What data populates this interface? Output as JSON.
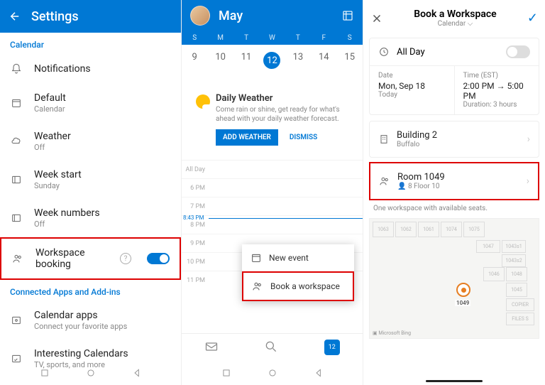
{
  "settings": {
    "title": "Settings",
    "section1": "Calendar",
    "items": [
      {
        "title": "Notifications",
        "sub": ""
      },
      {
        "title": "Default",
        "sub": "Calendar"
      },
      {
        "title": "Weather",
        "sub": "Off"
      },
      {
        "title": "Week start",
        "sub": "Sunday"
      },
      {
        "title": "Week numbers",
        "sub": "Off"
      },
      {
        "title": "Workspace booking",
        "sub": ""
      }
    ],
    "section2": "Connected Apps and Add-ins",
    "items2": [
      {
        "title": "Calendar apps",
        "sub": "Connect your favorite apps"
      },
      {
        "title": "Interesting Calendars",
        "sub": "TV, sports, and more"
      }
    ]
  },
  "calendar": {
    "month": "May",
    "dow": [
      "S",
      "M",
      "T",
      "W",
      "T",
      "F",
      "S"
    ],
    "dates": [
      "9",
      "10",
      "11",
      "12",
      "13",
      "14",
      "15"
    ],
    "selected": "12",
    "weather": {
      "title": "Daily Weather",
      "sub": "Come rain or shine, get ready for what's ahead with your daily weather forecast.",
      "add": "ADD WEATHER",
      "dismiss": "DISMISS"
    },
    "allday": "All Day",
    "times": [
      "6 PM",
      "7 PM",
      "8 PM",
      "9 PM",
      "10 PM",
      "11 PM"
    ],
    "now": "8:43 PM",
    "menu": {
      "new": "New event",
      "book": "Book a workspace"
    },
    "badge": "12"
  },
  "book": {
    "title": "Book a Workspace",
    "sub": "Calendar",
    "allday": "All Day",
    "date": {
      "label": "Date",
      "val": "Mon, Sep 18",
      "sub": "Today"
    },
    "time": {
      "label": "Time (EST)",
      "val": "2:00 PM → 5:00 PM",
      "sub": "Duration: 3 hours"
    },
    "building": {
      "title": "Building 2",
      "sub": "Buffalo"
    },
    "room": {
      "title": "Room 1049",
      "sub": "8  Floor 10"
    },
    "avail": "One workspace with available seats.",
    "pin": "1049",
    "bing": "Microsoft Bing",
    "rooms": [
      "1063",
      "1062",
      "1061",
      "1074",
      "1075",
      "1047",
      "1043s1",
      "1043s2",
      "1046",
      "1048",
      "1045",
      "COPIER",
      "FILES S"
    ]
  }
}
